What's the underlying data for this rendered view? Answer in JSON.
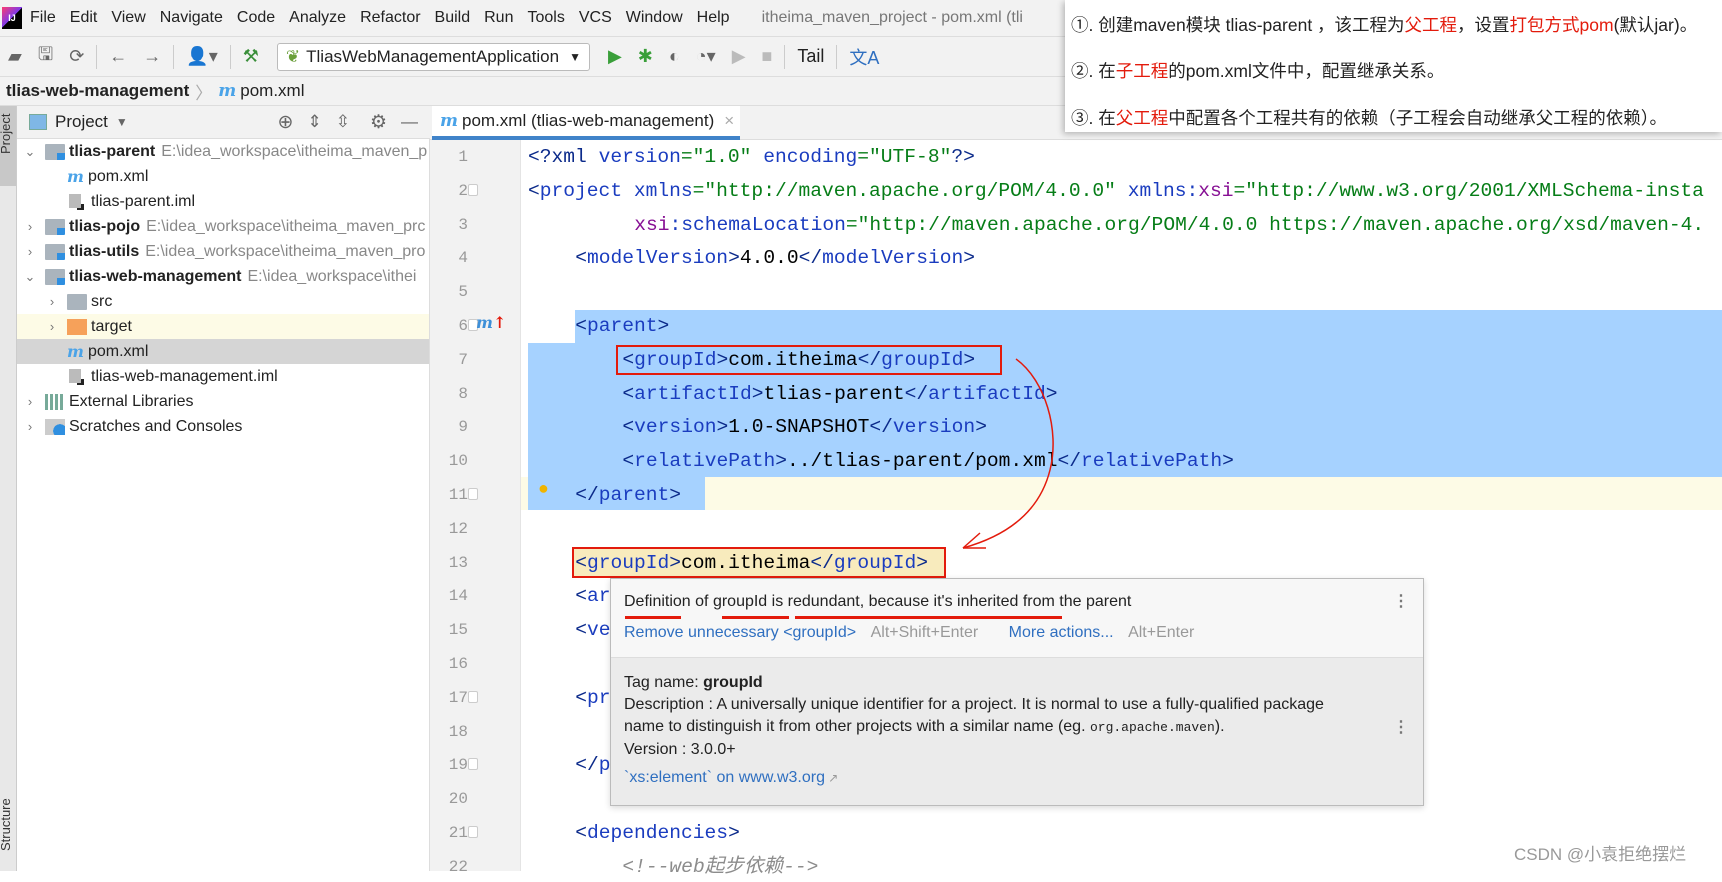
{
  "menu": {
    "items": [
      "File",
      "Edit",
      "View",
      "Navigate",
      "Code",
      "Analyze",
      "Refactor",
      "Build",
      "Run",
      "Tools",
      "VCS",
      "Window",
      "Help"
    ],
    "window_title": "itheima_maven_project - pom.xml (tli"
  },
  "toolbar": {
    "run_config": "TliasWebManagementApplication",
    "tail": "Tail"
  },
  "breadcrumb": {
    "project": "tlias-web-management",
    "file": "pom.xml"
  },
  "side_strip": {
    "project": "Project",
    "structure": "Structure"
  },
  "project_panel": {
    "title": "Project",
    "tree": [
      {
        "label": "tlias-parent",
        "path": "E:\\idea_workspace\\itheima_maven_p",
        "bold": true,
        "level": 0,
        "arrow": "down",
        "icon": "module-folder-icon"
      },
      {
        "label": "pom.xml",
        "level": 1,
        "icon": "maven-icon"
      },
      {
        "label": "tlias-parent.iml",
        "level": 1,
        "icon": "iml-file-icon"
      },
      {
        "label": "tlias-pojo",
        "path": "E:\\idea_workspace\\itheima_maven_prc",
        "bold": true,
        "level": 0,
        "arrow": "right",
        "icon": "module-folder-icon"
      },
      {
        "label": "tlias-utils",
        "path": "E:\\idea_workspace\\itheima_maven_pro",
        "bold": true,
        "level": 0,
        "arrow": "right",
        "icon": "module-folder-icon"
      },
      {
        "label": "tlias-web-management",
        "path": "E:\\idea_workspace\\ithei",
        "bold": true,
        "level": 0,
        "arrow": "down",
        "icon": "module-folder-icon"
      },
      {
        "label": "src",
        "level": 1,
        "arrow": "right",
        "icon": "folder-icon"
      },
      {
        "label": "target",
        "level": 1,
        "arrow": "right",
        "icon": "excluded-folder-icon",
        "highlight": "#fdfbe6"
      },
      {
        "label": "pom.xml",
        "level": 1,
        "icon": "maven-icon",
        "highlight": "#d5d5d5"
      },
      {
        "label": "tlias-web-management.iml",
        "level": 1,
        "icon": "iml-file-icon"
      },
      {
        "label": "External Libraries",
        "level": 0,
        "arrow": "right",
        "icon": "libraries-icon"
      },
      {
        "label": "Scratches and Consoles",
        "level": 0,
        "arrow": "right",
        "icon": "scratches-icon"
      }
    ]
  },
  "editor": {
    "tab_label": "pom.xml (tlias-web-management)",
    "lines": [
      {
        "n": "1",
        "indent": 0,
        "tokens": [
          [
            "<?xml ",
            "b"
          ],
          [
            "version",
            "a"
          ],
          [
            "=\"1.0\" ",
            "v"
          ],
          [
            "encoding",
            "a"
          ],
          [
            "=\"UTF-8\"",
            "v"
          ],
          [
            "?>",
            "b"
          ]
        ]
      },
      {
        "n": "2",
        "indent": 0,
        "tokens": [
          [
            "<",
            "b"
          ],
          [
            "project ",
            "n"
          ],
          [
            "xmlns",
            "a"
          ],
          [
            "=\"http://maven.apache.org/POM/4.0.0\" ",
            "v"
          ],
          [
            "xmlns:",
            "a"
          ],
          [
            "xsi",
            "ns"
          ],
          [
            "=\"http://www.w3.org/2001/XMLSchema-insta",
            "v"
          ]
        ]
      },
      {
        "n": "3",
        "indent": 9,
        "tokens": [
          [
            "xsi",
            "ns"
          ],
          [
            ":schemaLocation",
            "a"
          ],
          [
            "=\"http://maven.apache.org/POM/4.0.0 https://maven.apache.org/xsd/maven-4.",
            "v"
          ]
        ]
      },
      {
        "n": "4",
        "indent": 4,
        "tokens": [
          [
            "<",
            "b"
          ],
          [
            "modelVersion",
            "n"
          ],
          [
            ">",
            "b"
          ],
          [
            "4.0.0",
            ""
          ],
          [
            "</",
            "b"
          ],
          [
            "modelVersion",
            "n"
          ],
          [
            ">",
            "b"
          ]
        ]
      },
      {
        "n": "5",
        "indent": 0,
        "tokens": []
      },
      {
        "n": "6",
        "indent": 4,
        "tokens": [
          [
            "<",
            "b"
          ],
          [
            "parent",
            "n"
          ],
          [
            ">",
            "b"
          ]
        ]
      },
      {
        "n": "7",
        "indent": 8,
        "tokens": [
          [
            "<",
            "b"
          ],
          [
            "groupId",
            "n"
          ],
          [
            ">",
            "b"
          ],
          [
            "com.itheima",
            ""
          ],
          [
            "</",
            "b"
          ],
          [
            "groupId",
            "n"
          ],
          [
            ">",
            "b"
          ]
        ]
      },
      {
        "n": "8",
        "indent": 8,
        "tokens": [
          [
            "<",
            "b"
          ],
          [
            "artifactId",
            "n"
          ],
          [
            ">",
            "b"
          ],
          [
            "tlias-parent",
            ""
          ],
          [
            "</",
            "b"
          ],
          [
            "artifactId",
            "n"
          ],
          [
            ">",
            "b"
          ]
        ]
      },
      {
        "n": "9",
        "indent": 8,
        "tokens": [
          [
            "<",
            "b"
          ],
          [
            "version",
            "n"
          ],
          [
            ">",
            "b"
          ],
          [
            "1.0-SNAPSHOT",
            ""
          ],
          [
            "</",
            "b"
          ],
          [
            "version",
            "n"
          ],
          [
            ">",
            "b"
          ]
        ]
      },
      {
        "n": "10",
        "indent": 8,
        "tokens": [
          [
            "<",
            "b"
          ],
          [
            "relativePath",
            "n"
          ],
          [
            ">",
            "b"
          ],
          [
            "../tlias-parent/pom.xml",
            ""
          ],
          [
            "</",
            "b"
          ],
          [
            "relativePath",
            "n"
          ],
          [
            ">",
            "b"
          ]
        ]
      },
      {
        "n": "11",
        "indent": 4,
        "tokens": [
          [
            "</",
            "b"
          ],
          [
            "parent",
            "n"
          ],
          [
            ">",
            "b"
          ]
        ]
      },
      {
        "n": "12",
        "indent": 0,
        "tokens": []
      },
      {
        "n": "13",
        "indent": 4,
        "tokens": [
          [
            "<",
            "b"
          ],
          [
            "groupId",
            "n"
          ],
          [
            ">",
            "b"
          ],
          [
            "com.itheima",
            ""
          ],
          [
            "</",
            "b"
          ],
          [
            "groupId",
            "n"
          ],
          [
            ">",
            "b"
          ]
        ]
      },
      {
        "n": "14",
        "indent": 4,
        "tokens": [
          [
            "<",
            "b"
          ],
          [
            "ar",
            "n"
          ]
        ]
      },
      {
        "n": "15",
        "indent": 4,
        "tokens": [
          [
            "<",
            "b"
          ],
          [
            "ve",
            "n"
          ]
        ]
      },
      {
        "n": "16",
        "indent": 0,
        "tokens": []
      },
      {
        "n": "17",
        "indent": 4,
        "tokens": [
          [
            "<",
            "b"
          ],
          [
            "pr",
            "n"
          ]
        ]
      },
      {
        "n": "18",
        "indent": 0,
        "tokens": []
      },
      {
        "n": "19",
        "indent": 4,
        "tokens": [
          [
            "</",
            "b"
          ],
          [
            "p",
            "n"
          ]
        ]
      },
      {
        "n": "20",
        "indent": 0,
        "tokens": []
      },
      {
        "n": "21",
        "indent": 4,
        "tokens": [
          [
            "<",
            "b"
          ],
          [
            "dependencies",
            "n"
          ],
          [
            ">",
            "b"
          ]
        ]
      },
      {
        "n": "22",
        "indent": 8,
        "tokens": [
          [
            "<!--web起步依赖-->",
            "c"
          ]
        ]
      }
    ]
  },
  "tooltip": {
    "message": "Definition of groupId is redundant, because it's inherited from the parent",
    "fix_label": "Remove unnecessary <groupId>",
    "fix_shortcut": "Alt+Shift+Enter",
    "more_label": "More actions...",
    "more_shortcut": "Alt+Enter",
    "tag_label": "Tag name: ",
    "tag_name": "groupId",
    "description_1": "Description : A universally unique identifier for a project. It is normal to use a fully-qualified package",
    "description_2": "name to distinguish it from other projects with a similar name (eg. ",
    "description_code": "org.apache.maven",
    "description_end": ").",
    "version": "Version : 3.0.0+",
    "link": "`xs:element` on www.w3.org"
  },
  "annotation": {
    "line1": [
      [
        "①. 创建maven模块 tlias-parent ，该工程为",
        ""
      ],
      [
        "父工程",
        "r"
      ],
      [
        "，设置",
        ""
      ],
      [
        "打包方式pom",
        "r"
      ],
      [
        "(默认jar)。",
        ""
      ]
    ],
    "line2": [
      [
        "②. 在",
        ""
      ],
      [
        "子工程",
        "r"
      ],
      [
        "的pom.xml文件中，配置继承关系。",
        ""
      ]
    ],
    "line3": [
      [
        "③. 在",
        ""
      ],
      [
        "父工程",
        "r"
      ],
      [
        "中配置各个工程共有的依赖（子工程会自动继承父工程的依赖）。",
        ""
      ]
    ]
  },
  "watermark": "CSDN @小袁拒绝摆烂",
  "colors": {
    "selection": "#a6d2ff",
    "annotation_red": "#e31b0c",
    "accent": "#4083c9"
  }
}
